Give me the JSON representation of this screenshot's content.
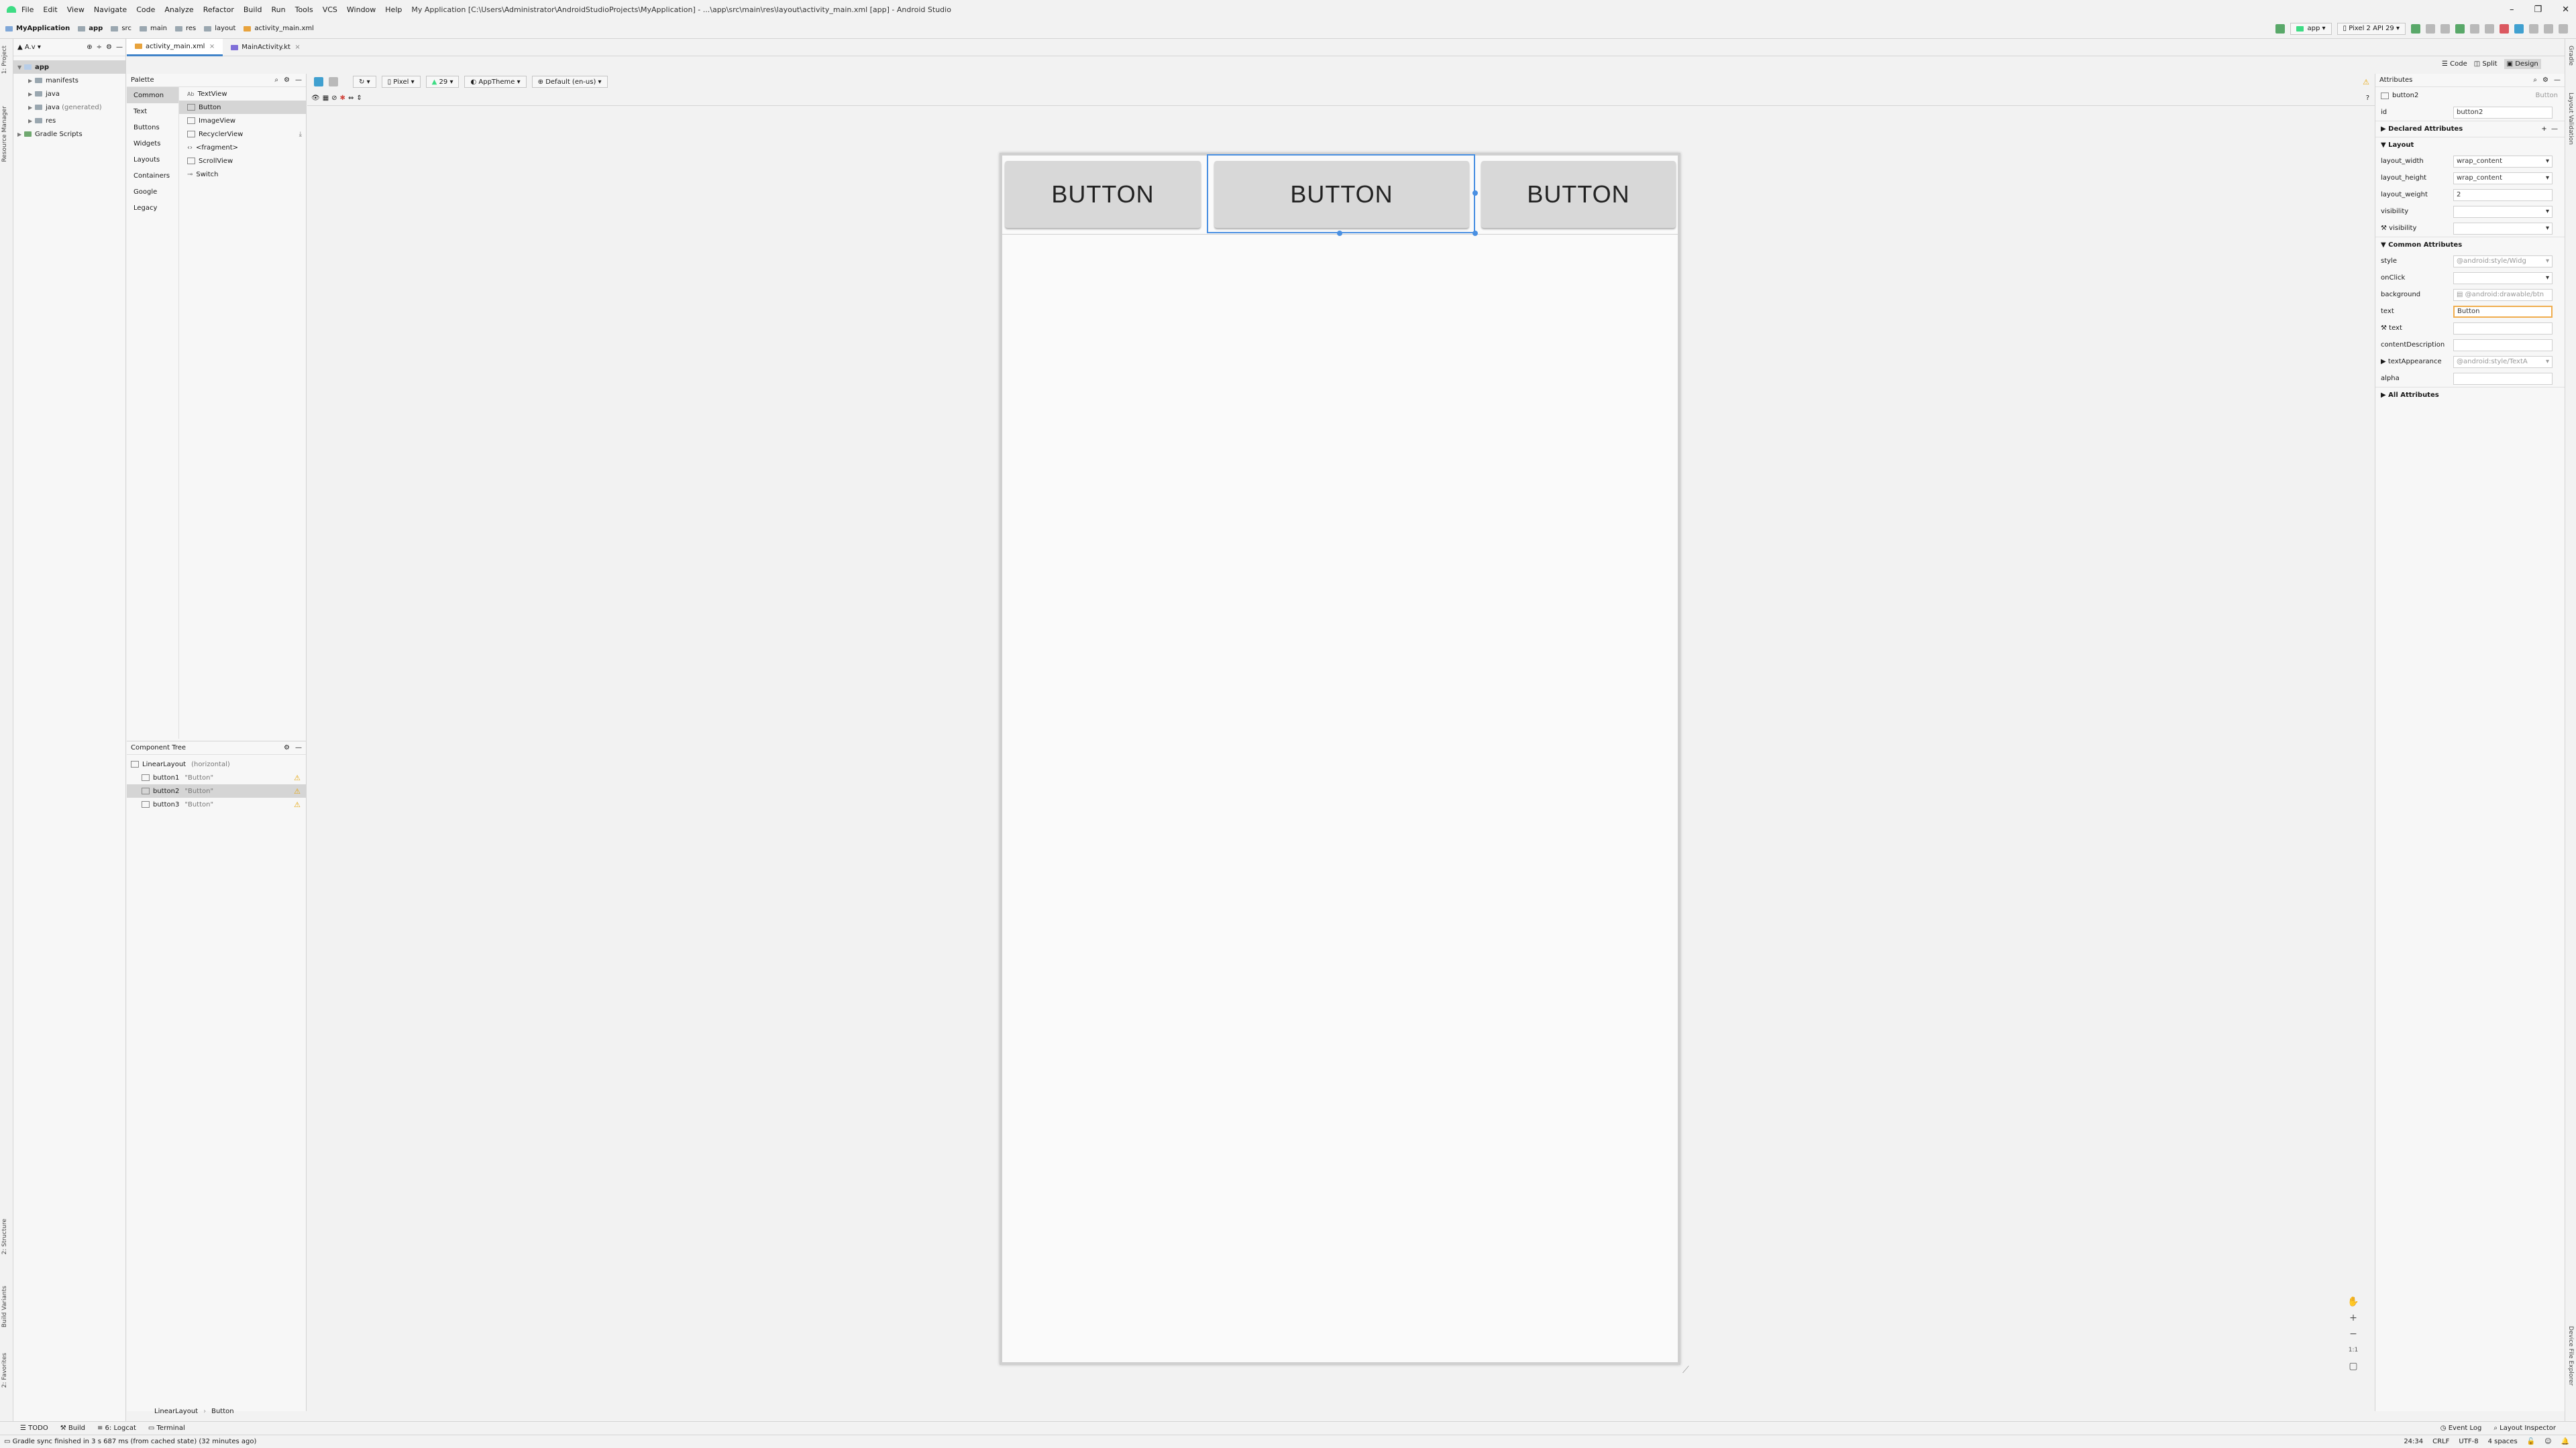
{
  "titlebar": {
    "menu": [
      "File",
      "Edit",
      "View",
      "Navigate",
      "Code",
      "Analyze",
      "Refactor",
      "Build",
      "Run",
      "Tools",
      "VCS",
      "Window",
      "Help"
    ],
    "title": "My Application [C:\\Users\\Administrator\\AndroidStudioProjects\\MyApplication] - ...\\app\\src\\main\\res\\layout\\activity_main.xml [app] - Android Studio"
  },
  "navbar": {
    "breadcrumbs": [
      "MyApplication",
      "app",
      "src",
      "main",
      "res",
      "layout",
      "activity_main.xml"
    ],
    "run_config": "app",
    "device": "Pixel 2 API 29"
  },
  "project": {
    "view_label": "A.v",
    "tree": [
      {
        "label": "app",
        "level": 0,
        "expanded": true
      },
      {
        "label": "manifests",
        "level": 1
      },
      {
        "label": "java",
        "level": 1
      },
      {
        "label": "java",
        "suffix": "(generated)",
        "level": 1
      },
      {
        "label": "res",
        "level": 1
      },
      {
        "label": "Gradle Scripts",
        "level": 0
      }
    ],
    "left_tabs": [
      "1: Project",
      "Resource Manager",
      "2: Structure",
      "Build Variants",
      "2: Favorites"
    ]
  },
  "editor_tabs": [
    {
      "label": "activity_main.xml",
      "active": true
    },
    {
      "label": "MainActivity.kt",
      "active": false
    }
  ],
  "view_modes": [
    "Code",
    "Split",
    "Design"
  ],
  "palette": {
    "title": "Palette",
    "categories": [
      "Common",
      "Text",
      "Buttons",
      "Widgets",
      "Layouts",
      "Containers",
      "Google",
      "Legacy"
    ],
    "selected_category": "Common",
    "items": [
      "TextView",
      "Button",
      "ImageView",
      "RecyclerView",
      "<fragment>",
      "ScrollView",
      "Switch"
    ],
    "selected_item": "Button"
  },
  "design_toolbar": {
    "device": "Pixel",
    "api": "29",
    "theme": "AppTheme",
    "locale": "Default (en-us)"
  },
  "component_tree": {
    "title": "Component Tree",
    "root": {
      "name": "LinearLayout",
      "detail": "(horizontal)"
    },
    "children": [
      {
        "name": "button1",
        "detail": "\"Button\"",
        "warning": true
      },
      {
        "name": "button2",
        "detail": "\"Button\"",
        "warning": true,
        "selected": true
      },
      {
        "name": "button3",
        "detail": "\"Button\"",
        "warning": true
      }
    ]
  },
  "preview": {
    "buttons": [
      "BUTTON",
      "BUTTON",
      "BUTTON"
    ],
    "selected_index": 1
  },
  "attributes": {
    "title": "Attributes",
    "component": "button2",
    "component_type": "Button",
    "id_label": "id",
    "id": "button2",
    "declared_label": "Declared Attributes",
    "layout_label": "Layout",
    "layout_rows": [
      {
        "label": "layout_width",
        "value": "wrap_content"
      },
      {
        "label": "layout_height",
        "value": "wrap_content"
      },
      {
        "label": "layout_weight",
        "value": "2"
      },
      {
        "label": "visibility",
        "value": ""
      },
      {
        "label": "visibility",
        "value": "",
        "tool": true
      }
    ],
    "common_label": "Common Attributes",
    "common_rows": [
      {
        "label": "style",
        "value": "@android:style/Widg"
      },
      {
        "label": "onClick",
        "value": ""
      },
      {
        "label": "background",
        "value": "@android:drawable/btn"
      },
      {
        "label": "text",
        "value": "Button"
      },
      {
        "label": "text",
        "value": "",
        "tool": true
      },
      {
        "label": "contentDescription",
        "value": ""
      },
      {
        "label": "textAppearance",
        "value": "@android:style/TextA"
      },
      {
        "label": "alpha",
        "value": ""
      }
    ],
    "all_label": "All Attributes"
  },
  "breadcrumb_bottom": [
    "LinearLayout",
    "Button"
  ],
  "bottom_tabs": [
    "TODO",
    "Build",
    "6: Logcat",
    "Terminal"
  ],
  "bottom_right_tabs": [
    "Event Log",
    "Layout Inspector"
  ],
  "status": {
    "message": "Gradle sync finished in 3 s 687 ms (from cached state) (32 minutes ago)",
    "position": "24:34",
    "line_sep": "CRLF",
    "encoding": "UTF-8",
    "indent": "4 spaces"
  },
  "right_strip_tabs": [
    "Gradle",
    "Layout Validation",
    "Device File Explorer"
  ],
  "colors": {
    "accent": "#4a90e2",
    "warning": "#e5a50a",
    "focus": "#f0ad4e"
  }
}
